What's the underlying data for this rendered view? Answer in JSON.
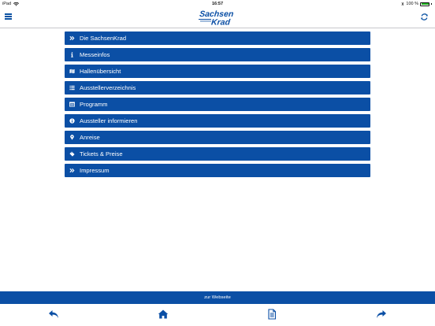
{
  "statusbar": {
    "device": "iPad",
    "time": "16:57",
    "battery_text": "100 %"
  },
  "navbar": {
    "brand": "SachsenKrad"
  },
  "menu": [
    {
      "label": "Die SachsenKrad",
      "icon": "double-chevron-right-icon"
    },
    {
      "label": "Messeinfos",
      "icon": "info-icon"
    },
    {
      "label": "Hallenübersicht",
      "icon": "map-icon"
    },
    {
      "label": "Ausstellerverzeichnis",
      "icon": "list-icon"
    },
    {
      "label": "Programm",
      "icon": "schedule-icon"
    },
    {
      "label": "Aussteller informieren",
      "icon": "info-circle-icon"
    },
    {
      "label": "Anreise",
      "icon": "map-marker-icon"
    },
    {
      "label": "Tickets & Preise",
      "icon": "ticket-icon"
    },
    {
      "label": "Impressum",
      "icon": "double-chevron-right-icon"
    }
  ],
  "footer": {
    "website_label": "zur Webseite"
  },
  "tabbar": {
    "icons": [
      "back-arrow-icon",
      "home-icon",
      "document-icon",
      "forward-arrow-icon"
    ]
  },
  "colors": {
    "primary": "#0b4fa5",
    "background": "#ffffff"
  }
}
